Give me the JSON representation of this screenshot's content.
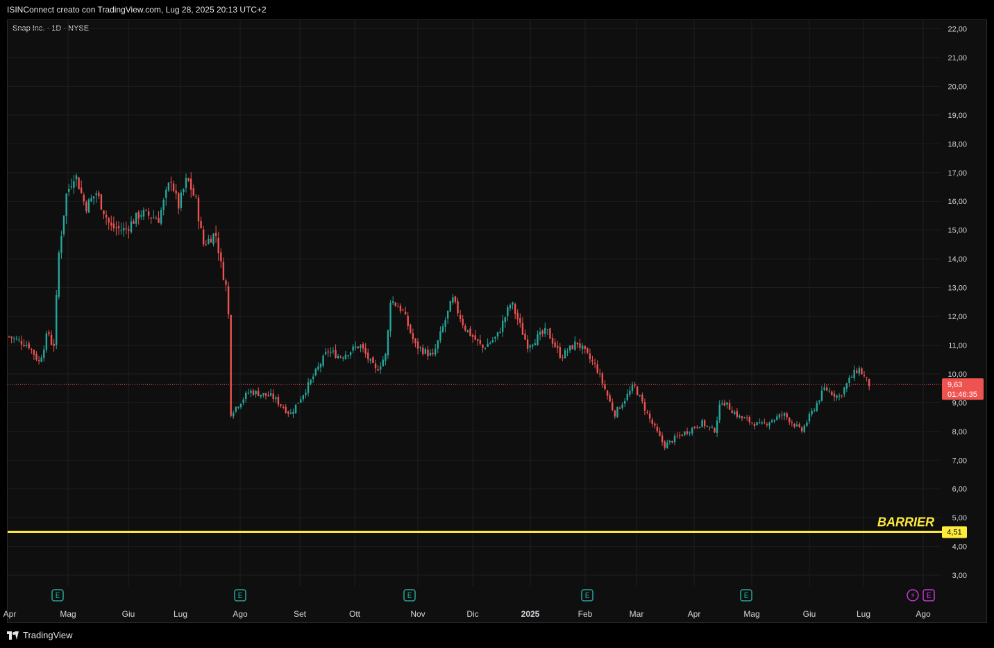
{
  "header": {
    "text": "ISINConnect creato con TradingView.com, Lug 28, 2025 20:13 UTC+2"
  },
  "symbol": {
    "name": "Snap Inc.",
    "interval": "1D",
    "exchange": "NYSE",
    "separator": "·"
  },
  "footer": {
    "brand": "TradingView"
  },
  "colors": {
    "background": "#0f0f0f",
    "grid": "#1f1f1f",
    "up": "#26a69a",
    "down": "#ef5350",
    "barrier": "#ffeb3b",
    "axis_text": "#d1d4dc"
  },
  "chart_data": {
    "type": "candlestick",
    "y_axis": {
      "min": 2.4,
      "max": 22.3,
      "position": "right",
      "ticks": [
        "3,00",
        "4,00",
        "5,00",
        "6,00",
        "7,00",
        "8,00",
        "9,00",
        "10,00",
        "11,00",
        "12,00",
        "13,00",
        "14,00",
        "15,00",
        "16,00",
        "17,00",
        "18,00",
        "19,00",
        "20,00",
        "21,00",
        "22,00"
      ]
    },
    "x_axis": {
      "labels": [
        "Apr",
        "Mag",
        "Giu",
        "Lug",
        "Ago",
        "Set",
        "Ott",
        "Nov",
        "Dic",
        "2025",
        "Feb",
        "Mar",
        "Apr",
        "Mag",
        "Giu",
        "Lug",
        "Ago"
      ]
    },
    "grid": true,
    "last_price": {
      "value": 9.63,
      "label": "9,63",
      "countdown": "01:46:35"
    },
    "barrier": {
      "value": 4.51,
      "label": "4,51",
      "name": "BARRIER"
    },
    "events": [
      {
        "type": "earnings",
        "icon": "E",
        "month": "Mag 2024"
      },
      {
        "type": "earnings",
        "icon": "E",
        "month": "Ago 2024"
      },
      {
        "type": "earnings",
        "icon": "E",
        "month": "Nov 2024"
      },
      {
        "type": "earnings",
        "icon": "E",
        "month": "Feb 2025"
      },
      {
        "type": "earnings",
        "icon": "E",
        "month": "Mag 2025"
      },
      {
        "type": "dividend-flash",
        "icon": "⚡",
        "month": "Ago 2025"
      },
      {
        "type": "earnings-upcoming",
        "icon": "E",
        "month": "Ago 2025"
      }
    ],
    "series_path": [
      [
        "2024-04-01",
        11.3
      ],
      [
        "2024-04-12",
        11.0
      ],
      [
        "2024-04-18",
        10.4
      ],
      [
        "2024-04-23",
        11.5
      ],
      [
        "2024-04-26",
        10.8
      ],
      [
        "2024-04-29",
        14.2
      ],
      [
        "2024-05-03",
        16.2
      ],
      [
        "2024-05-08",
        17.0
      ],
      [
        "2024-05-14",
        15.8
      ],
      [
        "2024-05-20",
        16.3
      ],
      [
        "2024-05-28",
        15.1
      ],
      [
        "2024-06-05",
        15.0
      ],
      [
        "2024-06-14",
        15.6
      ],
      [
        "2024-06-24",
        15.4
      ],
      [
        "2024-07-01",
        16.8
      ],
      [
        "2024-07-05",
        15.8
      ],
      [
        "2024-07-10",
        16.8
      ],
      [
        "2024-07-15",
        16.0
      ],
      [
        "2024-07-19",
        14.5
      ],
      [
        "2024-07-26",
        14.9
      ],
      [
        "2024-07-29",
        13.8
      ],
      [
        "2024-08-01",
        13.0
      ],
      [
        "2024-08-02",
        12.9
      ],
      [
        "2024-08-03",
        8.6
      ],
      [
        "2024-08-14",
        9.4
      ],
      [
        "2024-08-27",
        9.2
      ],
      [
        "2024-09-06",
        8.6
      ],
      [
        "2024-09-16",
        9.6
      ],
      [
        "2024-09-27",
        10.8
      ],
      [
        "2024-10-04",
        10.6
      ],
      [
        "2024-10-15",
        11.0
      ],
      [
        "2024-10-24",
        10.1
      ],
      [
        "2024-10-30",
        10.7
      ],
      [
        "2024-11-01",
        12.6
      ],
      [
        "2024-11-08",
        12.2
      ],
      [
        "2024-11-15",
        11.0
      ],
      [
        "2024-11-25",
        10.6
      ],
      [
        "2024-12-06",
        12.6
      ],
      [
        "2024-12-13",
        11.6
      ],
      [
        "2024-12-23",
        10.9
      ],
      [
        "2024-12-31",
        11.3
      ],
      [
        "2025-01-08",
        12.5
      ],
      [
        "2025-01-17",
        11.0
      ],
      [
        "2025-01-28",
        11.5
      ],
      [
        "2025-02-05",
        10.6
      ],
      [
        "2025-02-14",
        11.1
      ],
      [
        "2025-02-25",
        10.2
      ],
      [
        "2025-03-07",
        8.6
      ],
      [
        "2025-03-18",
        9.6
      ],
      [
        "2025-03-27",
        8.4
      ],
      [
        "2025-04-04",
        7.5
      ],
      [
        "2025-04-11",
        7.8
      ],
      [
        "2025-04-25",
        8.3
      ],
      [
        "2025-05-02",
        8.0
      ],
      [
        "2025-05-06",
        9.1
      ],
      [
        "2025-05-16",
        8.5
      ],
      [
        "2025-05-28",
        8.2
      ],
      [
        "2025-06-10",
        8.6
      ],
      [
        "2025-06-20",
        8.0
      ],
      [
        "2025-06-27",
        8.8
      ],
      [
        "2025-07-03",
        9.5
      ],
      [
        "2025-07-11",
        9.2
      ],
      [
        "2025-07-18",
        9.9
      ],
      [
        "2025-07-22",
        10.2
      ],
      [
        "2025-07-28",
        9.63
      ]
    ]
  }
}
